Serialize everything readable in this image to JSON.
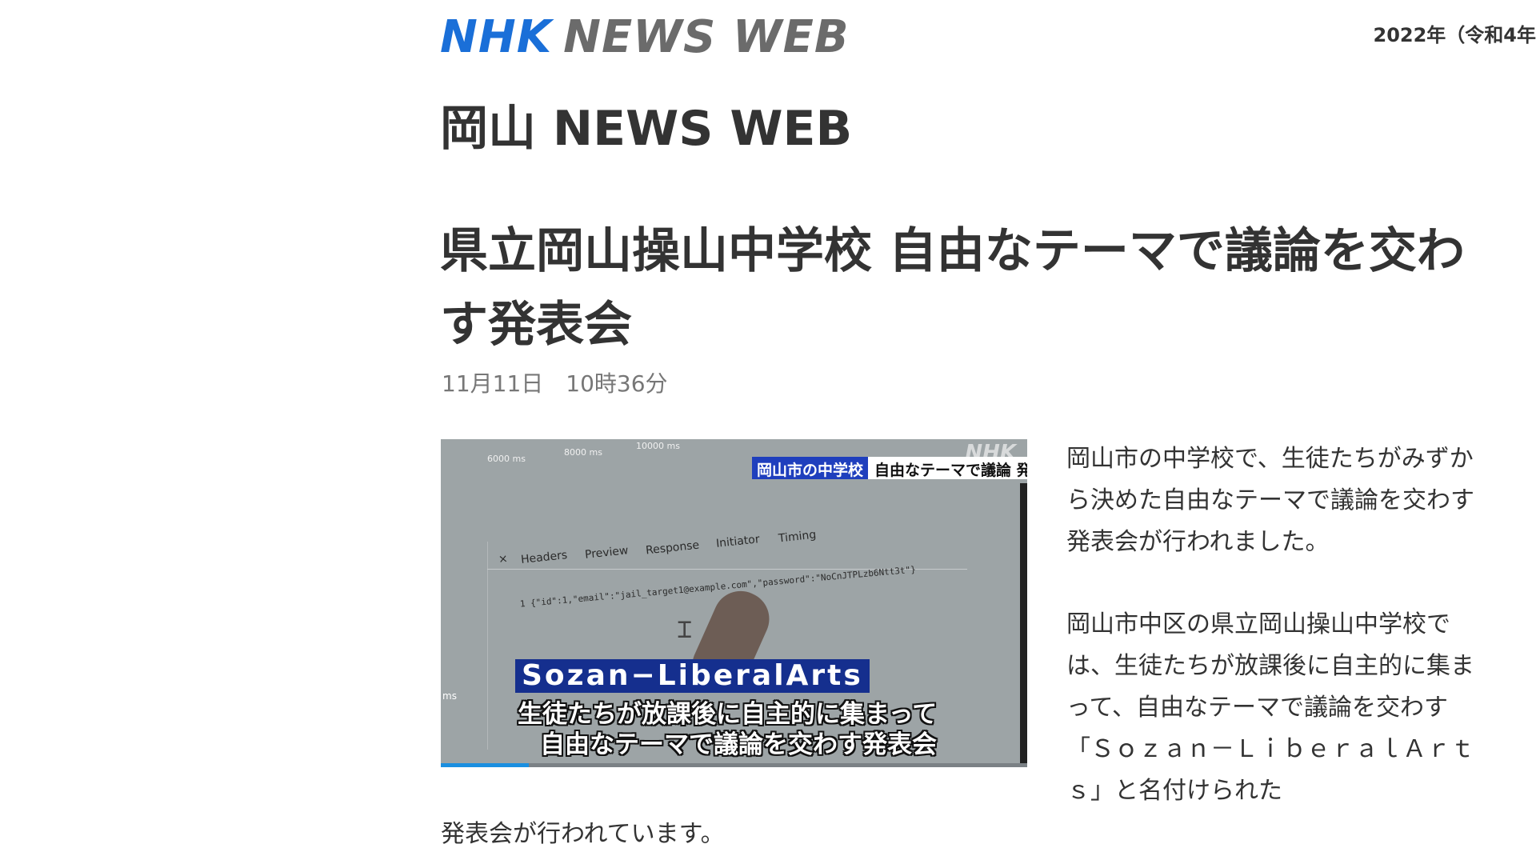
{
  "header": {
    "logo_nhk": "NHK",
    "logo_newsweb": "NEWS WEB",
    "date": "2022年（令和4年"
  },
  "region_title": "岡山 NEWS WEB",
  "article": {
    "headline": "県立岡山操山中学校 自由なテーマで議論を交わす発表会",
    "timestamp": "11月11日　10時36分",
    "para1": "岡山市の中学校で、生徒たちがみずから決めた自由なテーマで議論を交わす発表会が行われました。",
    "para2": "岡山市中区の県立岡山操山中学校では、生徒たちが放課後に自主的に集まって、自由なテーマで議論を交わす「Ｓｏｚａｎ－ＬｉｂｅｒａｌＡｒｔｓ」と名付けられた",
    "para2_tail": "発表会が行われています。"
  },
  "video": {
    "caption_location": "岡山市の中学校",
    "caption_topic": "自由なテーマで議論 発表会",
    "watermark": "NHK",
    "subtitle_title": "Sozan−LiberalArts",
    "subtitle_line1": "生徒たちが放課後に自主的に集まって",
    "subtitle_line2": "自由なテーマで議論を交わす発表会",
    "screen_ticks": [
      "6000 ms",
      "8000 ms",
      "10000 ms"
    ],
    "screen_tabs": [
      "×",
      "Headers",
      "Preview",
      "Response",
      "Initiator",
      "Timing"
    ],
    "screen_code": "1 {\"id\":1,\"email\":\"jail_target1@example.com\",\"password\":\"NoCnJTPLzb6Ntt3t\"}",
    "screen_ms": "ms",
    "progress_fraction": 0.15
  }
}
